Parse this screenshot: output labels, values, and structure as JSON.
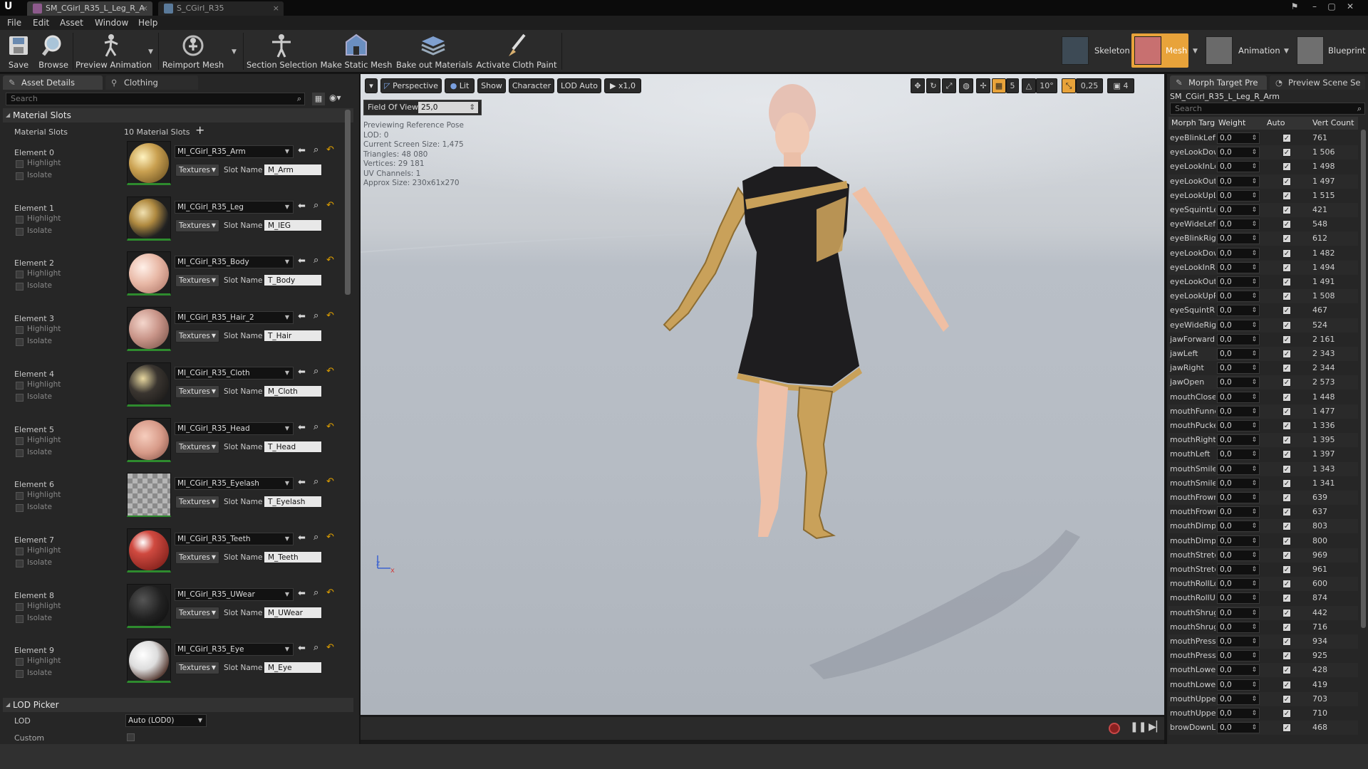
{
  "titlebar": {
    "tabs": [
      {
        "label": "SM_CGirl_R35_L_Leg_R_A"
      },
      {
        "label": "S_CGirl_R35"
      }
    ]
  },
  "menu": {
    "items": [
      "File",
      "Edit",
      "Asset",
      "Window",
      "Help"
    ]
  },
  "toolbar": {
    "buttons": {
      "save": "Save",
      "browse": "Browse",
      "preview_animation": "Preview Animation",
      "reimport_mesh": "Reimport Mesh",
      "section_selection": "Section Selection",
      "make_static_mesh": "Make Static Mesh",
      "bake_out_materials": "Bake out Materials",
      "activate_cloth_paint": "Activate Cloth Paint"
    },
    "modes": {
      "skeleton": "Skeleton",
      "mesh": "Mesh",
      "animation": "Animation",
      "blueprint": "Blueprint"
    },
    "accent": "#e8a33a"
  },
  "left": {
    "tabs": {
      "asset_details": "Asset Details",
      "clothing": "Clothing"
    },
    "search_placeholder": "Search",
    "material_slots_header": "Material Slots",
    "material_slots_label": "Material Slots",
    "material_slots_count": "10 Material Slots",
    "highlight_label": "Highlight",
    "isolate_label": "Isolate",
    "textures_label": "Textures",
    "slot_name_label": "Slot Name",
    "elements": [
      {
        "label": "Element 0",
        "material": "MI_CGirl_R35_Arm",
        "slot": "M_Arm",
        "swatch": "gold"
      },
      {
        "label": "Element 1",
        "material": "MI_CGirl_R35_Leg",
        "slot": "M_lEG",
        "swatch": "goldblack"
      },
      {
        "label": "Element 2",
        "material": "MI_CGirl_R35_Body",
        "slot": "T_Body",
        "swatch": "skin"
      },
      {
        "label": "Element 3",
        "material": "MI_CGirl_R35_Hair_2",
        "slot": "T_Hair",
        "swatch": "hair"
      },
      {
        "label": "Element 4",
        "material": "MI_CGirl_R35_Cloth",
        "slot": "M_Cloth",
        "swatch": "cloth"
      },
      {
        "label": "Element 5",
        "material": "MI_CGirl_R35_Head",
        "slot": "T_Head",
        "swatch": "head"
      },
      {
        "label": "Element 6",
        "material": "MI_CGirl_R35_Eyelash",
        "slot": "T_Eyelash",
        "swatch": "checker"
      },
      {
        "label": "Element 7",
        "material": "MI_CGirl_R35_Teeth",
        "slot": "M_Teeth",
        "swatch": "red"
      },
      {
        "label": "Element 8",
        "material": "MI_CGirl_R35_UWear",
        "slot": "M_UWear",
        "swatch": "black"
      },
      {
        "label": "Element 9",
        "material": "MI_CGirl_R35_Eye",
        "slot": "M_Eye",
        "swatch": "eye"
      }
    ],
    "lod_picker_header": "LOD Picker",
    "lod_label": "LOD",
    "lod_value": "Auto (LOD0)",
    "custom_label": "Custom"
  },
  "viewport": {
    "perspective": "Perspective",
    "lit": "Lit",
    "show": "Show",
    "character": "Character",
    "lod": "LOD Auto",
    "speed": "x1,0",
    "fov_label": "Field Of View",
    "fov_value": "25,0",
    "grid_value": "5",
    "angle_value": "10°",
    "scale_value": "0,25",
    "camera_value": "4",
    "stats": [
      "Previewing Reference Pose",
      "LOD: 0",
      "Current Screen Size: 1,475",
      "Triangles: 48 080",
      "Vertices: 29 181",
      "UV Channels: 1",
      "Approx Size: 230x61x270"
    ]
  },
  "right": {
    "tabs": {
      "morph": "Morph Target Pre",
      "preview_scene": "Preview Scene Se"
    },
    "asset_name": "SM_CGirl_R35_L_Leg_R_Arm",
    "search_placeholder": "Search",
    "columns": {
      "name": "Morph Targ",
      "weight": "Weight",
      "auto": "Auto",
      "vert": "Vert Count"
    },
    "rows": [
      {
        "name": "eyeBlinkLeft",
        "weight": "0,0",
        "vert": "761"
      },
      {
        "name": "eyeLookDownLeft",
        "weight": "0,0",
        "vert": "1 506"
      },
      {
        "name": "eyeLookInLeft",
        "weight": "0,0",
        "vert": "1 498"
      },
      {
        "name": "eyeLookOutLeft",
        "weight": "0,0",
        "vert": "1 497"
      },
      {
        "name": "eyeLookUpLeft",
        "weight": "0,0",
        "vert": "1 515"
      },
      {
        "name": "eyeSquintLeft",
        "weight": "0,0",
        "vert": "421"
      },
      {
        "name": "eyeWideLeft",
        "weight": "0,0",
        "vert": "548"
      },
      {
        "name": "eyeBlinkRight",
        "weight": "0,0",
        "vert": "612"
      },
      {
        "name": "eyeLookDownRight",
        "weight": "0,0",
        "vert": "1 482"
      },
      {
        "name": "eyeLookInRight",
        "weight": "0,0",
        "vert": "1 494"
      },
      {
        "name": "eyeLookOutRight",
        "weight": "0,0",
        "vert": "1 491"
      },
      {
        "name": "eyeLookUpRight",
        "weight": "0,0",
        "vert": "1 508"
      },
      {
        "name": "eyeSquintRight",
        "weight": "0,0",
        "vert": "467"
      },
      {
        "name": "eyeWideRight",
        "weight": "0,0",
        "vert": "524"
      },
      {
        "name": "jawForward",
        "weight": "0,0",
        "vert": "2 161"
      },
      {
        "name": "jawLeft",
        "weight": "0,0",
        "vert": "2 343"
      },
      {
        "name": "jawRight",
        "weight": "0,0",
        "vert": "2 344"
      },
      {
        "name": "jawOpen",
        "weight": "0,0",
        "vert": "2 573"
      },
      {
        "name": "mouthClose",
        "weight": "0,0",
        "vert": "1 448"
      },
      {
        "name": "mouthFunnel",
        "weight": "0,0",
        "vert": "1 477"
      },
      {
        "name": "mouthPucker",
        "weight": "0,0",
        "vert": "1 336"
      },
      {
        "name": "mouthRight",
        "weight": "0,0",
        "vert": "1 395"
      },
      {
        "name": "mouthLeft",
        "weight": "0,0",
        "vert": "1 397"
      },
      {
        "name": "mouthSmileLeft",
        "weight": "0,0",
        "vert": "1 343"
      },
      {
        "name": "mouthSmileRight",
        "weight": "0,0",
        "vert": "1 341"
      },
      {
        "name": "mouthFrownLeft",
        "weight": "0,0",
        "vert": "639"
      },
      {
        "name": "mouthFrownRight",
        "weight": "0,0",
        "vert": "637"
      },
      {
        "name": "mouthDimpleLeft",
        "weight": "0,0",
        "vert": "803"
      },
      {
        "name": "mouthDimpleRight",
        "weight": "0,0",
        "vert": "800"
      },
      {
        "name": "mouthStretchLeft",
        "weight": "0,0",
        "vert": "969"
      },
      {
        "name": "mouthStretchRight",
        "weight": "0,0",
        "vert": "961"
      },
      {
        "name": "mouthRollLower",
        "weight": "0,0",
        "vert": "600"
      },
      {
        "name": "mouthRollUpper",
        "weight": "0,0",
        "vert": "874"
      },
      {
        "name": "mouthShrugLower",
        "weight": "0,0",
        "vert": "442"
      },
      {
        "name": "mouthShrugUpper",
        "weight": "0,0",
        "vert": "716"
      },
      {
        "name": "mouthPressLeft",
        "weight": "0,0",
        "vert": "934"
      },
      {
        "name": "mouthPressRight",
        "weight": "0,0",
        "vert": "925"
      },
      {
        "name": "mouthLowerDownLeft",
        "weight": "0,0",
        "vert": "428"
      },
      {
        "name": "mouthLowerDownRight",
        "weight": "0,0",
        "vert": "419"
      },
      {
        "name": "mouthUpperUpLeft",
        "weight": "0,0",
        "vert": "703"
      },
      {
        "name": "mouthUpperUpRight",
        "weight": "0,0",
        "vert": "710"
      },
      {
        "name": "browDownLeft",
        "weight": "0,0",
        "vert": "468"
      }
    ]
  }
}
